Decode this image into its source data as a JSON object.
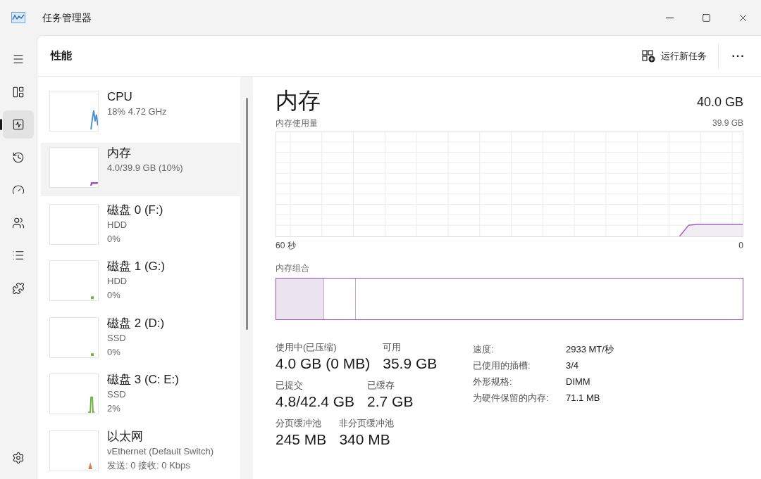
{
  "window": {
    "title": "任务管理器"
  },
  "nav": [
    {
      "kind": "menu",
      "selected": false
    },
    {
      "kind": "processes",
      "selected": false
    },
    {
      "kind": "performance",
      "selected": true
    },
    {
      "kind": "history",
      "selected": false
    },
    {
      "kind": "startup",
      "selected": false
    },
    {
      "kind": "users",
      "selected": false
    },
    {
      "kind": "details",
      "selected": false
    },
    {
      "kind": "services",
      "selected": false
    }
  ],
  "header": {
    "title": "性能",
    "run_task": "运行新任务",
    "more": "···"
  },
  "devices": [
    {
      "name": "CPU",
      "lines": [
        "18% 4.72 GHz"
      ],
      "color": "#4a8fcf",
      "selected": false,
      "kind": "cpu"
    },
    {
      "name": "内存",
      "lines": [
        "4.0/39.9 GB (10%)"
      ],
      "color": "#9b4fc4",
      "selected": true,
      "kind": "memory"
    },
    {
      "name": "磁盘 0 (F:)",
      "lines": [
        "HDD",
        "0%"
      ],
      "selected": false,
      "kind": "flat"
    },
    {
      "name": "磁盘 1 (G:)",
      "lines": [
        "HDD",
        "0%"
      ],
      "color": "#6cb33f",
      "selected": false,
      "kind": "dot"
    },
    {
      "name": "磁盘 2 (D:)",
      "lines": [
        "SSD",
        "0%"
      ],
      "color": "#6cb33f",
      "selected": false,
      "kind": "dot"
    },
    {
      "name": "磁盘 3 (C: E:)",
      "lines": [
        "SSD",
        "2%"
      ],
      "color": "#6cb33f",
      "selected": false,
      "kind": "spike"
    },
    {
      "name": "以太网",
      "lines": [
        "vEthernet (Default Switch)",
        "发送: 0 接收: 0 Kbps"
      ],
      "color": "#e0794a",
      "selected": false,
      "kind": "peak"
    }
  ],
  "detail": {
    "title": "内存",
    "total": "40.0 GB",
    "usage_label": "内存使用量",
    "usage_max": "39.9 GB",
    "time_start": "60 秒",
    "time_end": "0",
    "composition_label": "内存组合",
    "composition": [
      {
        "kind": "in_use",
        "level": 0.103
      },
      {
        "kind": "modified",
        "level": 0.068
      }
    ],
    "stats": [
      [
        {
          "label": "使用中(已压缩)",
          "value": "4.0 GB (0 MB)"
        },
        {
          "label": "可用",
          "value": "35.9 GB"
        }
      ],
      [
        {
          "label": "已提交",
          "value": "4.8/42.4 GB"
        },
        {
          "label": "已缓存",
          "value": "2.7 GB"
        }
      ],
      [
        {
          "label": "分页缓冲池",
          "value": "245 MB"
        },
        {
          "label": "非分页缓冲池",
          "value": "340 MB"
        }
      ]
    ],
    "properties": [
      {
        "label": "速度:",
        "value": "2933 MT/秒"
      },
      {
        "label": "已使用的插槽:",
        "value": "3/4"
      },
      {
        "label": "外形规格:",
        "value": "DIMM"
      },
      {
        "label": "为硬件保留的内存:",
        "value": "71.1 MB"
      }
    ]
  }
}
